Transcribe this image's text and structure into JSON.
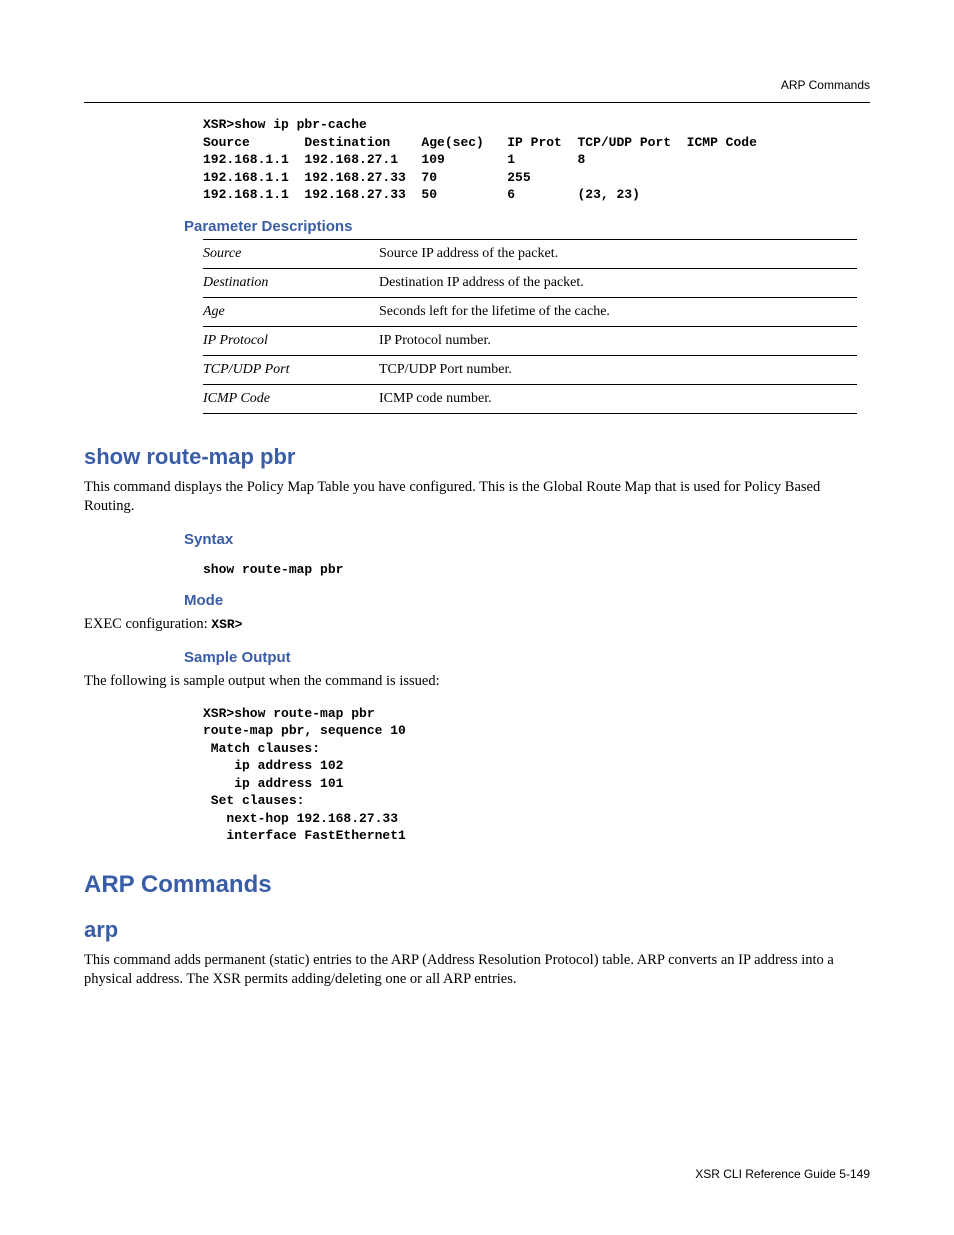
{
  "header": {
    "section": "ARP Commands"
  },
  "cli_output_1": "XSR>show ip pbr-cache\nSource       Destination    Age(sec)   IP Prot  TCP/UDP Port  ICMP Code\n192.168.1.1  192.168.27.1   109        1        8\n192.168.1.1  192.168.27.33  70         255\n192.168.1.1  192.168.27.33  50         6        (23, 23)",
  "param_sec_title": "Parameter Descriptions",
  "params": [
    {
      "name": "Source",
      "desc": "Source IP address of the packet."
    },
    {
      "name": "Destination",
      "desc": "Destination IP address of the packet."
    },
    {
      "name": "Age",
      "desc": "Seconds left for the lifetime of the cache."
    },
    {
      "name": "IP Protocol",
      "desc": "IP Protocol number."
    },
    {
      "name": "TCP/UDP Port",
      "desc": "TCP/UDP Port number."
    },
    {
      "name": "ICMP Code",
      "desc": "ICMP code number."
    }
  ],
  "routemap": {
    "title": "show route-map pbr",
    "desc": "This command displays the Policy Map Table you have configured. This is the Global Route Map that is used for Policy Based Routing.",
    "syntax_label": "Syntax",
    "syntax_cmd": "show route-map pbr",
    "mode_label": "Mode",
    "mode_text_prefix": "EXEC configuration: ",
    "mode_text_cmd": "XSR>",
    "sample_label": "Sample Output",
    "sample_intro": "The following is sample output when the command is issued:",
    "sample_output": "XSR>show route-map pbr\nroute-map pbr, sequence 10\n Match clauses:\n    ip address 102\n    ip address 101\n Set clauses:\n   next-hop 192.168.27.33\n   interface FastEthernet1"
  },
  "arp_section": {
    "heading": "ARP Commands",
    "cmd_title": "arp",
    "desc": "This command adds permanent (static) entries to the ARP (Address Resolution Protocol) table. ARP converts an IP address into a physical address. The XSR permits adding/deleting one or all ARP entries."
  },
  "footer": {
    "text": "XSR CLI Reference Guide    5-149"
  }
}
